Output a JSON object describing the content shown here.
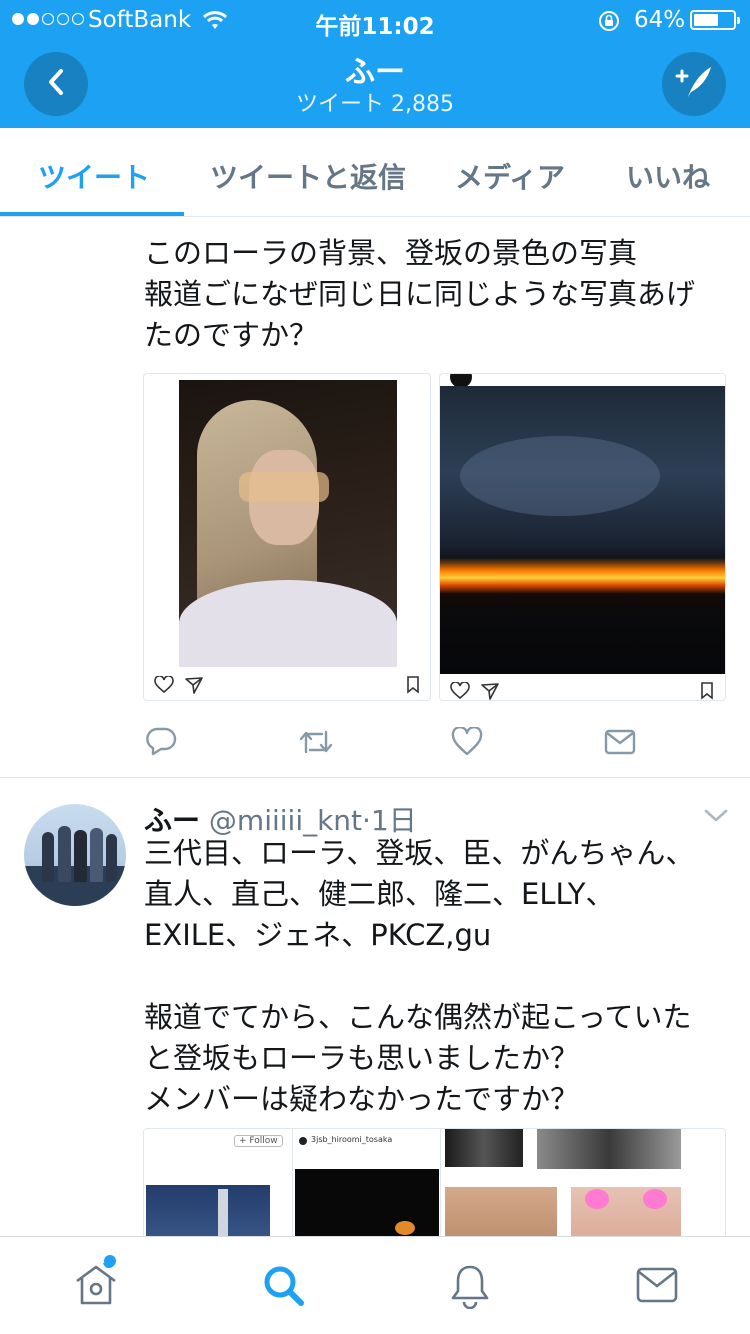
{
  "status": {
    "carrier": "SoftBank",
    "time": "午前11:02",
    "battery": "64%",
    "battery_level": 0.64
  },
  "header": {
    "name": "ふー",
    "tweet_count": "ツイート 2,885"
  },
  "tabs": [
    "ツイート",
    "ツイートと返信",
    "メディア",
    "いいね"
  ],
  "tweet1": {
    "text": "このローラの背景、登坂の景色の写真\n報道ごになぜ同じ日に同じような写真あげ\nたのですか？"
  },
  "tweet2": {
    "name": "ふー",
    "handle": "@miiiii_knt",
    "sep": "·",
    "time": "1日",
    "text": "三代目、ローラ、登坂、臣、がんちゃん、\n直人、直己、健二郎、隆二、ELLY、\nEXILE、ジェネ、PKCZ,gu\n\n報道でてから、こんな偶然が起こっていた\nと登坂もローラも思いましたか？\nメンバーは疑わなかったですか？",
    "embed_follow": "+ Follow",
    "embed_user": "3jsb_hiroomi_tosaka"
  },
  "icons": {
    "back": "back-arrow-icon",
    "compose": "compose-tweet-icon",
    "reply": "reply-icon",
    "retweet": "retweet-icon",
    "like": "heart-icon",
    "dm": "envelope-icon"
  },
  "colors": {
    "brand": "#1da1f2",
    "muted": "#657786",
    "action": "#8899a6"
  }
}
